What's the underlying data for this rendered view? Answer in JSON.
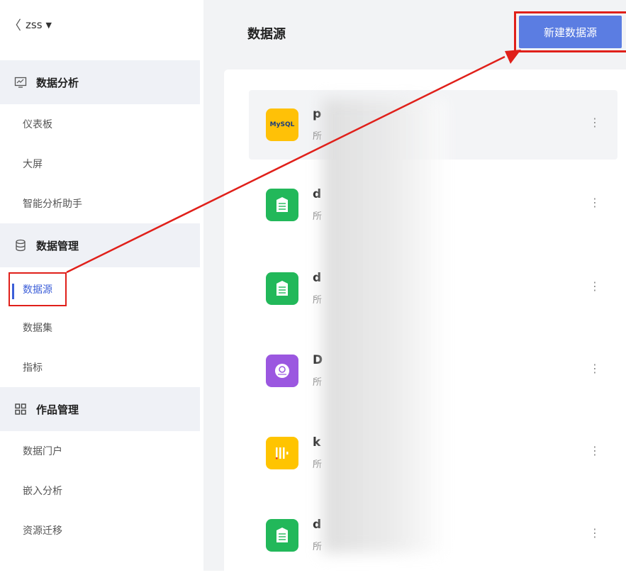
{
  "workspace": {
    "name": "zss"
  },
  "sidebar": {
    "groups": [
      {
        "label": "数据分析",
        "icon": "chart-monitor-icon"
      },
      {
        "label": "数据管理",
        "icon": "database-icon"
      },
      {
        "label": "作品管理",
        "icon": "grid-icon"
      }
    ],
    "items": [
      {
        "label": "仪表板"
      },
      {
        "label": "大屏"
      },
      {
        "label": "智能分析助手"
      },
      {
        "label": "数据源",
        "active": true
      },
      {
        "label": "数据集"
      },
      {
        "label": "指标"
      },
      {
        "label": "数据门户"
      },
      {
        "label": "嵌入分析"
      },
      {
        "label": "资源迁移"
      }
    ]
  },
  "main": {
    "title": "数据源",
    "new_button": "新建数据源",
    "datasources": [
      {
        "name": "p",
        "sub": "所",
        "icon": "mysql-icon",
        "icon_text": "MySQL",
        "color": "#ffc107"
      },
      {
        "name": "d",
        "sub": "所",
        "icon": "table-icon",
        "color": "#22b85a"
      },
      {
        "name": "d",
        "sub": "所",
        "icon": "table-icon",
        "color": "#22b85a"
      },
      {
        "name": "D",
        "sub": "所",
        "icon": "db-purple-icon",
        "color": "#9b57e0"
      },
      {
        "name": "k",
        "sub": "所",
        "icon": "bars-icon",
        "color": "#ffc400"
      },
      {
        "name": "d",
        "sub": "所",
        "icon": "table-icon",
        "color": "#22b85a"
      }
    ],
    "more_glyph": "⋮"
  },
  "colors": {
    "accent": "#5b7de2",
    "annotation": "#e0201a"
  }
}
